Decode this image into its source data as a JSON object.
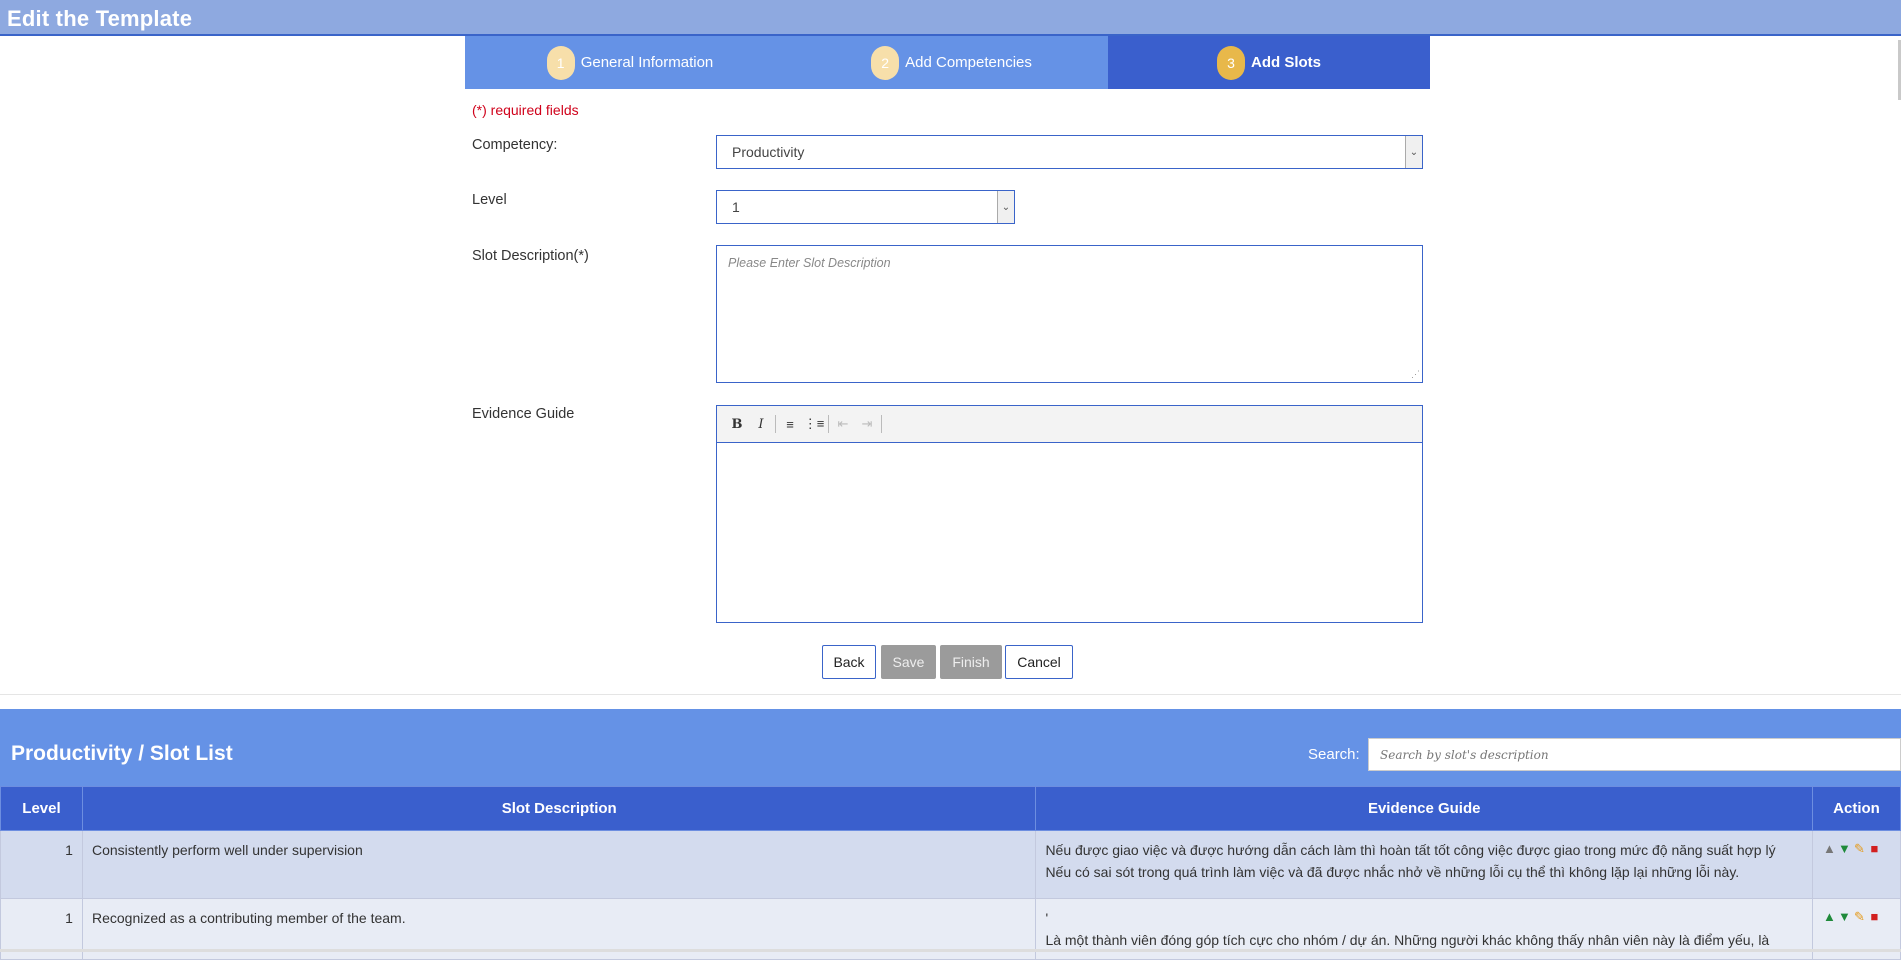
{
  "window": {
    "title": "Edit the Template"
  },
  "wizard": {
    "steps": [
      {
        "num": "1",
        "label": "General Information"
      },
      {
        "num": "2",
        "label": "Add Competencies"
      },
      {
        "num": "3",
        "label": "Add Slots"
      }
    ],
    "active_step": 3
  },
  "form": {
    "required_note": "(*) required fields",
    "competency_label": "Competency:",
    "competency_value": "Productivity",
    "level_label": "Level",
    "level_value": "1",
    "slot_desc_label": "Slot Description(*)",
    "slot_desc_placeholder": "Please Enter Slot Description",
    "evidence_label": "Evidence Guide"
  },
  "buttons": {
    "back": "Back",
    "save": "Save",
    "finish": "Finish",
    "cancel": "Cancel"
  },
  "slot_list": {
    "title": "Productivity / Slot List",
    "search_label": "Search:",
    "search_placeholder": "Search by slot's description",
    "columns": [
      "Level",
      "Slot Description",
      "Evidence Guide",
      "Action"
    ],
    "rows": [
      {
        "level": "1",
        "description": "Consistently perform well under supervision",
        "evidence_line1": "Nếu được giao việc và được hướng dẫn cách làm thì hoàn tất tốt công việc được giao trong mức độ năng suất hợp lý",
        "evidence_line2": "Nếu có sai sót trong quá trình làm việc và đã được nhắc nhở về những lỗi cụ thể thì không lặp lại những lỗi này."
      },
      {
        "level": "1",
        "description": "Recognized as a contributing member of the team.",
        "evidence_line1": "'",
        "evidence_line2": "Là một thành viên đóng góp tích cực cho nhóm / dự án. Những người khác không thấy nhân viên này là điểm yếu, là"
      }
    ]
  },
  "colors": {
    "accent": "#3a5fcd",
    "header_light": "#6592e6",
    "required": "#d0021b"
  }
}
